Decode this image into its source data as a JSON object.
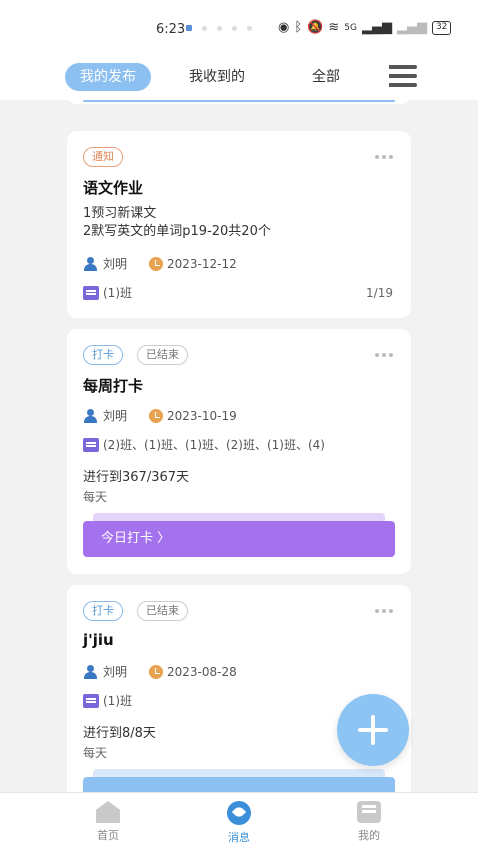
{
  "status_bar": {
    "time": "6:23",
    "battery": "32",
    "network": "5G"
  },
  "tabs": {
    "published": "我的发布",
    "received": "我收到的",
    "all": "全部"
  },
  "cards": [
    {
      "tag": "通知",
      "title": "语文作业",
      "lines": [
        "1预习新课文",
        "2默写英文的单词p19-20共20个"
      ],
      "author": "刘明",
      "date": "2023-12-12",
      "classes": "(1)班",
      "count": "1/19"
    },
    {
      "tag": "打卡",
      "status": "已结束",
      "title": "每周打卡",
      "author": "刘明",
      "date": "2023-10-19",
      "classes": "(2)班、(1)班、(1)班、(2)班、(1)班、(4)",
      "progress": "进行到367/367天",
      "frequency": "每天",
      "button": "今日打卡 〉"
    },
    {
      "tag": "打卡",
      "status": "已结束",
      "title": "j'jiu",
      "author": "刘明",
      "date": "2023-08-28",
      "classes": "(1)班",
      "progress": "进行到8/8天",
      "frequency": "每天"
    }
  ],
  "bottom_nav": {
    "home": "首页",
    "messages": "消息",
    "me": "我的"
  },
  "colors": {
    "accent": "#8cc0f0",
    "purple_button": "#a572ee",
    "active_nav": "#3b8fd8"
  }
}
